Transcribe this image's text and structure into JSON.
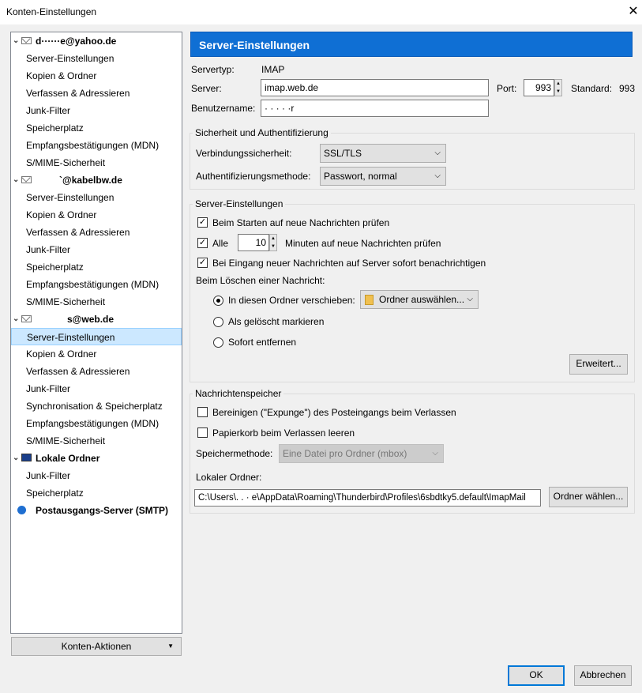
{
  "window": {
    "title": "Konten-Einstellungen",
    "close": "✕"
  },
  "tree": {
    "accounts": [
      {
        "name": "d······e@yahoo.de",
        "children": [
          "Server-Einstellungen",
          "Kopien & Ordner",
          "Verfassen & Adressieren",
          "Junk-Filter",
          "Speicherplatz",
          "Empfangsbestätigungen (MDN)",
          "S/MIME-Sicherheit"
        ]
      },
      {
        "name": "`@kabelbw.de",
        "children": [
          "Server-Einstellungen",
          "Kopien & Ordner",
          "Verfassen & Adressieren",
          "Junk-Filter",
          "Speicherplatz",
          "Empfangsbestätigungen (MDN)",
          "S/MIME-Sicherheit"
        ]
      },
      {
        "name": "s@web.de",
        "children": [
          "Server-Einstellungen",
          "Kopien & Ordner",
          "Verfassen & Adressieren",
          "Junk-Filter",
          "Synchronisation & Speicherplatz",
          "Empfangsbestätigungen (MDN)",
          "S/MIME-Sicherheit"
        ]
      },
      {
        "name": "Lokale Ordner",
        "children": [
          "Junk-Filter",
          "Speicherplatz"
        ]
      },
      {
        "name": "Postausgangs-Server (SMTP)",
        "children": []
      }
    ],
    "actions_button": "Konten-Aktionen"
  },
  "panel": {
    "header": "Server-Einstellungen",
    "servertype_label": "Servertyp:",
    "servertype_value": "IMAP",
    "server_label": "Server:",
    "server_value": "imap.web.de",
    "port_label": "Port:",
    "port_value": "993",
    "standard_label": "Standard:",
    "standard_value": "993",
    "username_label": "Benutzername:",
    "username_value": "· ·  ·   · ·r",
    "security": {
      "title": "Sicherheit und Authentifizierung",
      "conn_label": "Verbindungssicherheit:",
      "conn_value": "SSL/TLS",
      "auth_label": "Authentifizierungsmethode:",
      "auth_value": "Passwort, normal"
    },
    "server_settings": {
      "title": "Server-Einstellungen",
      "check_startup": "Beim Starten auf neue Nachrichten prüfen",
      "check_every": "Alle",
      "minutes_value": "10",
      "minutes_label": "Minuten auf neue Nachrichten prüfen",
      "notify_immediately": "Bei Eingang neuer Nachrichten auf Server sofort benachrichtigen",
      "delete_label": "Beim Löschen einer Nachricht:",
      "move_to_folder": "In diesen Ordner verschieben:",
      "folder_choose": "Ordner auswählen...",
      "mark_deleted": "Als gelöscht markieren",
      "remove_now": "Sofort entfernen",
      "advanced_button": "Erweitert..."
    },
    "storage": {
      "title": "Nachrichtenspeicher",
      "expunge": "Bereinigen (\"Expunge\") des Posteingangs beim Verlassen",
      "empty_trash": "Papierkorb beim Verlassen leeren",
      "method_label": "Speichermethode:",
      "method_value": "Eine Datei pro Ordner (mbox)",
      "local_folder_label": "Lokaler Ordner:",
      "local_folder_value": "C:\\Users\\. .  ·  e\\AppData\\Roaming\\Thunderbird\\Profiles\\6sbdtky5.default\\ImapMail",
      "choose_folder_button": "Ordner wählen..."
    }
  },
  "footer": {
    "ok": "OK",
    "cancel": "Abbrechen"
  },
  "colors": {
    "header_bg": "#0f6fd4",
    "selection_bg": "#cce8ff"
  }
}
